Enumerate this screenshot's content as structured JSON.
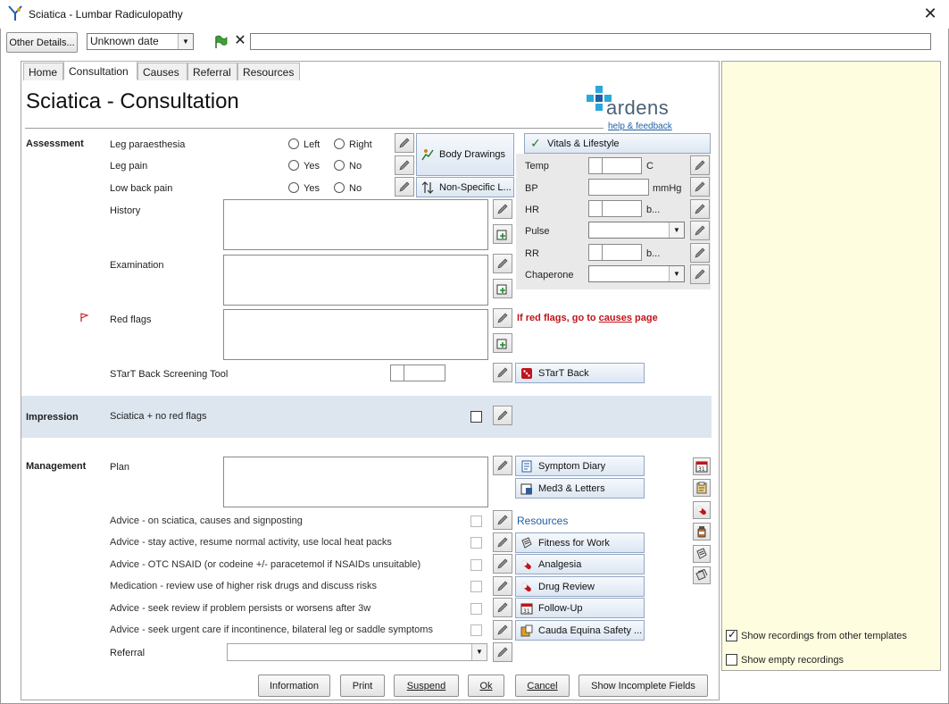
{
  "window": {
    "title": "Sciatica - Lumbar Radiculopathy",
    "close": "✕"
  },
  "toolbar": {
    "other_details": "Other Details...",
    "date_value": "Unknown date",
    "date_arrow": "▼",
    "clear_icon": "✕"
  },
  "tabs": [
    {
      "label": "Home"
    },
    {
      "label": "Consultation"
    },
    {
      "label": "Causes"
    },
    {
      "label": "Referral"
    },
    {
      "label": "Resources"
    }
  ],
  "page": {
    "title": "Sciatica - Consultation"
  },
  "brand": {
    "name": "ardens",
    "link": "help & feedback"
  },
  "assessment": {
    "label": "Assessment",
    "leg_paraesthesia": {
      "label": "Leg paraesthesia",
      "opt1": "Left",
      "opt2": "Right"
    },
    "leg_pain": {
      "label": "Leg pain",
      "opt1": "Yes",
      "opt2": "No"
    },
    "low_back_pain": {
      "label": "Low back pain",
      "opt1": "Yes",
      "opt2": "No"
    },
    "history": "History",
    "examination": "Examination",
    "red_flags": "Red flags",
    "red_flags_note": {
      "pre": "If red flags, go to ",
      "link": "causes",
      "post": " page"
    },
    "start_back_tool": "STarT Back Screening Tool",
    "body_drawings": "Body Drawings",
    "non_specific": "Non-Specific L...",
    "start_back_btn": "STarT Back"
  },
  "vitals": {
    "header": "Vitals & Lifestyle",
    "temp": {
      "label": "Temp",
      "unit": "C"
    },
    "bp": {
      "label": "BP",
      "unit": "mmHg"
    },
    "hr": {
      "label": "HR",
      "unit": "b..."
    },
    "pulse": {
      "label": "Pulse"
    },
    "rr": {
      "label": "RR",
      "unit": "b..."
    },
    "chaperone": {
      "label": "Chaperone"
    },
    "arrow": "▼"
  },
  "impression": {
    "label": "Impression",
    "item": "Sciatica + no red flags"
  },
  "management": {
    "label": "Management",
    "plan": "Plan",
    "advice": [
      "Advice - on sciatica, causes and signposting",
      "Advice - stay active, resume normal activity, use local heat packs",
      "Advice - OTC NSAID (or codeine +/- paracetemol if NSAIDs unsuitable)",
      "Medication - review use of higher risk drugs and discuss risks",
      "Advice - seek review if problem persists or worsens after 3w",
      "Advice - seek urgent care if incontinence, bilateral leg or saddle symptoms"
    ],
    "referral": "Referral",
    "symptom_diary": "Symptom Diary",
    "med3": "Med3 & Letters",
    "resources_head": "Resources",
    "fitness": "Fitness for Work",
    "analgesia": "Analgesia",
    "drug_review": "Drug Review",
    "follow_up": "Follow-Up",
    "cauda": "Cauda Equina Safety ...",
    "arrow": "▼"
  },
  "right_panel": {
    "show_other": "Show recordings from other templates",
    "show_empty": "Show empty recordings"
  },
  "buttons": {
    "information": "Information",
    "print": "Print",
    "suspend": "Suspend",
    "ok": "Ok",
    "cancel": "Cancel",
    "show_incomplete": "Show Incomplete Fields"
  },
  "colors": {
    "accent_blue": "#1f5fa6",
    "red": "#c0141b",
    "panel_yellow": "#fffde0",
    "impression_bg": "#dde6ef"
  }
}
